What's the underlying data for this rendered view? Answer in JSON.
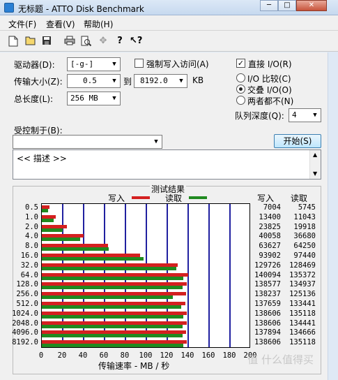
{
  "window": {
    "title": "无标题 - ATTO Disk Benchmark",
    "btn_min": "─",
    "btn_max": "□",
    "btn_close": "✕"
  },
  "menu": {
    "file": "文件(F)",
    "view": "查看(V)",
    "help": "帮助(H)"
  },
  "toolbar": {
    "icons": [
      "new-icon",
      "open-icon",
      "save-icon",
      "print-icon",
      "print-preview-icon",
      "move-icon",
      "help-icon",
      "context-help-icon"
    ]
  },
  "settings": {
    "drive_label": "驱动器(D):",
    "drive_value": "[-g-]",
    "force_write_label": "强制写入访问(A)",
    "direct_io_label": "直接 I/O(R)",
    "transfer_label": "传输大小(Z):",
    "transfer_from": "0.5",
    "to_label": "到",
    "transfer_to": "8192.0",
    "kb_label": "KB",
    "total_length_label": "总长度(L):",
    "total_length_value": "256 MB",
    "radio_io_compare": "I/O 比较(C)",
    "radio_overlapped": "交叠 I/O(O)",
    "radio_neither": "两者都不(N)",
    "queue_depth_label": "队列深度(Q):",
    "queue_depth_value": "4",
    "controlled_by_label": "受控制于(B):",
    "controlled_by_value": "",
    "start_button": "开始(S)",
    "description": "<< 描述 >>"
  },
  "results_title": "测试结果",
  "legend": {
    "write": "写入",
    "read": "读取"
  },
  "colors": {
    "write": "#d42020",
    "read": "#208a20",
    "grid": "#2020a0"
  },
  "columns": {
    "write": "写入",
    "read": "读取"
  },
  "chart_data": {
    "type": "bar",
    "categories": [
      "0.5",
      "1.0",
      "2.0",
      "4.0",
      "8.0",
      "16.0",
      "32.0",
      "64.0",
      "128.0",
      "256.0",
      "512.0",
      "1024.0",
      "2048.0",
      "4096.0",
      "8192.0"
    ],
    "series": [
      {
        "name": "写入",
        "values": [
          7004,
          13400,
          23825,
          40058,
          63627,
          93902,
          129726,
          140094,
          138577,
          138237,
          137659,
          138606,
          138606,
          137894,
          138606
        ]
      },
      {
        "name": "读取",
        "values": [
          5745,
          11043,
          19918,
          36680,
          64250,
          97440,
          128469,
          135372,
          134937,
          125136,
          133441,
          135118,
          134441,
          134666,
          135118
        ]
      }
    ],
    "xlabel": "传输速率 - MB / 秒",
    "xticks": [
      "0",
      "20",
      "40",
      "60",
      "80",
      "100",
      "120",
      "140",
      "160",
      "180",
      "200"
    ],
    "xlim": [
      0,
      200
    ],
    "grid": true
  },
  "watermark": "值 什么值得买"
}
